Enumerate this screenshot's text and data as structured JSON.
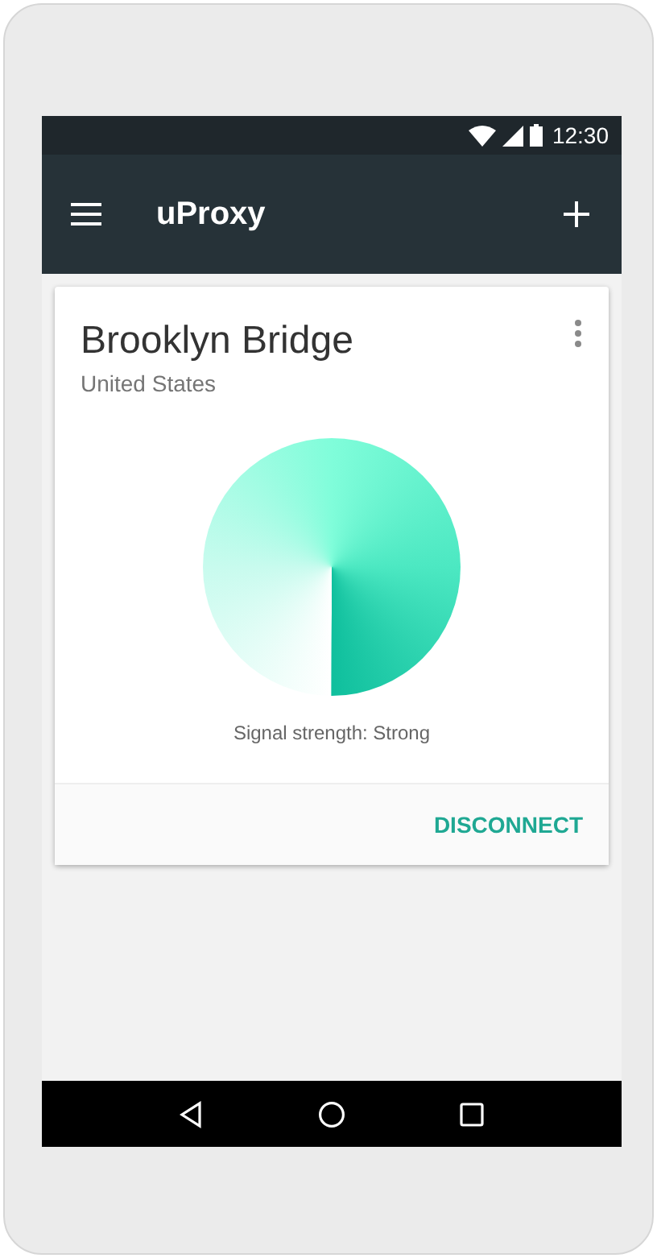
{
  "status_bar": {
    "time": "12:30"
  },
  "app_bar": {
    "title": "uProxy"
  },
  "card": {
    "title": "Brooklyn Bridge",
    "subtitle": "United States",
    "caption": "Signal strength: Strong",
    "action": "DISCONNECT"
  }
}
